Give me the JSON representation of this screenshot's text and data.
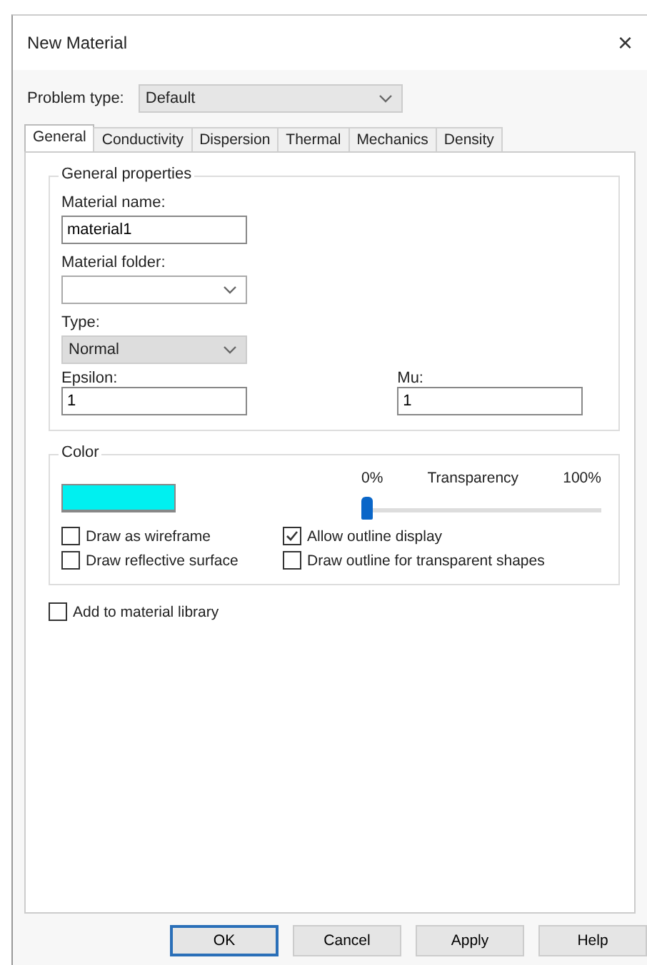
{
  "window": {
    "title": "New Material",
    "close": "×"
  },
  "problem_type": {
    "label": "Problem type:",
    "value": "Default"
  },
  "tabs": [
    {
      "label": "General",
      "selected": true
    },
    {
      "label": "Conductivity",
      "selected": false
    },
    {
      "label": "Dispersion",
      "selected": false
    },
    {
      "label": "Thermal",
      "selected": false
    },
    {
      "label": "Mechanics",
      "selected": false
    },
    {
      "label": "Density",
      "selected": false
    }
  ],
  "general_properties": {
    "title": "General properties",
    "material_name": {
      "label": "Material name:",
      "value": "material1"
    },
    "material_folder": {
      "label": "Material folder:"
    },
    "type": {
      "label": "Type:",
      "value": "Normal",
      "disabled": true
    },
    "epsilon": {
      "label": "Epsilon:",
      "value": "1"
    },
    "mu": {
      "label": "Mu:",
      "value": "1"
    }
  },
  "color_group": {
    "title": "Color",
    "color": "#00f0f0",
    "transparency": {
      "min_label": "0%",
      "label": "Transparency",
      "max_label": "100%",
      "level": 0
    },
    "checkboxes": [
      {
        "label": "Draw as wireframe",
        "checked": false
      },
      {
        "label": "Allow outline display",
        "checked": true
      },
      {
        "label": "Draw reflective surface",
        "checked": false
      },
      {
        "label": "Draw outline for transparent shapes",
        "checked": false
      }
    ]
  },
  "add_to_library": {
    "label": "Add to material library",
    "checked": false
  },
  "buttons": [
    {
      "label": "OK",
      "default": true
    },
    {
      "label": "Cancel",
      "default": false
    },
    {
      "label": "Apply",
      "default": false
    },
    {
      "label": "Help",
      "default": false
    }
  ]
}
